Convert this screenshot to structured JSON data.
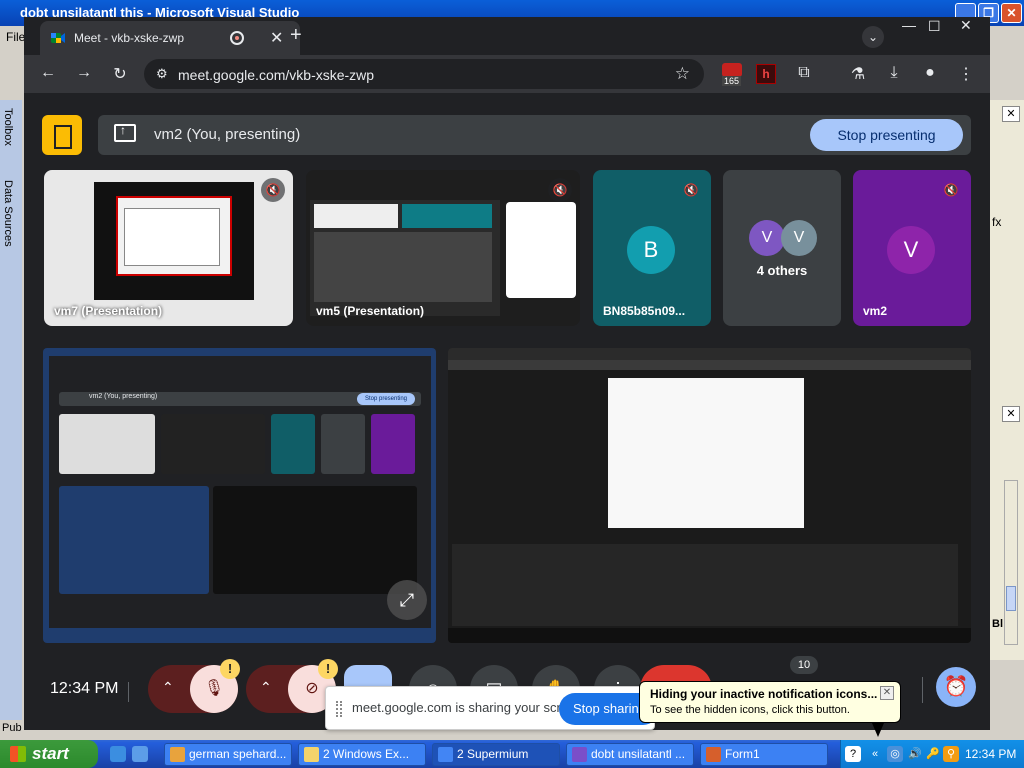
{
  "vs": {
    "title": "dobt unsilatantl this - Microsoft Visual Studio",
    "menu_first": "File",
    "toolbox_tab": "Toolbox",
    "datasources_tab": "Data Sources",
    "bottom_text": "Pub",
    "right_fx": "fx",
    "right_bl": "Bl"
  },
  "chrome": {
    "tab_title": "Meet - vkb-xske-zwp",
    "url": "meet.google.com/vkb-xske-zwp",
    "ext_badge_count": "165"
  },
  "meet": {
    "presenting_text": "vm2 (You, presenting)",
    "stop_presenting": "Stop presenting",
    "tiles": [
      {
        "label": "vm7 (Presentation)"
      },
      {
        "label": "vm5 (Presentation)"
      },
      {
        "label": "BN85b85n09...",
        "avatar": "B",
        "color": "#129eaf"
      },
      {
        "label": "4 others",
        "avatars": [
          "V",
          "V"
        ]
      },
      {
        "label": "vm2",
        "avatar": "V",
        "color": "#7b1fa2"
      }
    ],
    "time": "12:34 PM",
    "raise_count": "10",
    "self_view_nested_presenting": "vm2 (You, presenting)",
    "self_view_nested_stop": "Stop presenting"
  },
  "share_bar": {
    "text": "meet.google.com is sharing your screen.",
    "stop": "Stop sharing"
  },
  "balloon": {
    "title": "Hiding your inactive notification icons...",
    "body": "To see the hidden icons, click this button."
  },
  "taskbar": {
    "start": "start",
    "items": [
      {
        "label": "german spehard...",
        "color": "#e8a33d"
      },
      {
        "label": "2 Windows Ex...",
        "color": "#f3d36b"
      },
      {
        "label": "2 Supermium",
        "color": "#4285f4",
        "active": true
      },
      {
        "label": "dobt unsilatantl ...",
        "color": "#7a4ec9"
      },
      {
        "label": "Form1",
        "color": "#d65f2c"
      }
    ],
    "clock": "12:34 PM"
  },
  "colors": {
    "meet_bg": "#202124",
    "accent_blue": "#a8c7fa",
    "xp_blue": "#245edb",
    "start_green": "#3c9a3c"
  }
}
